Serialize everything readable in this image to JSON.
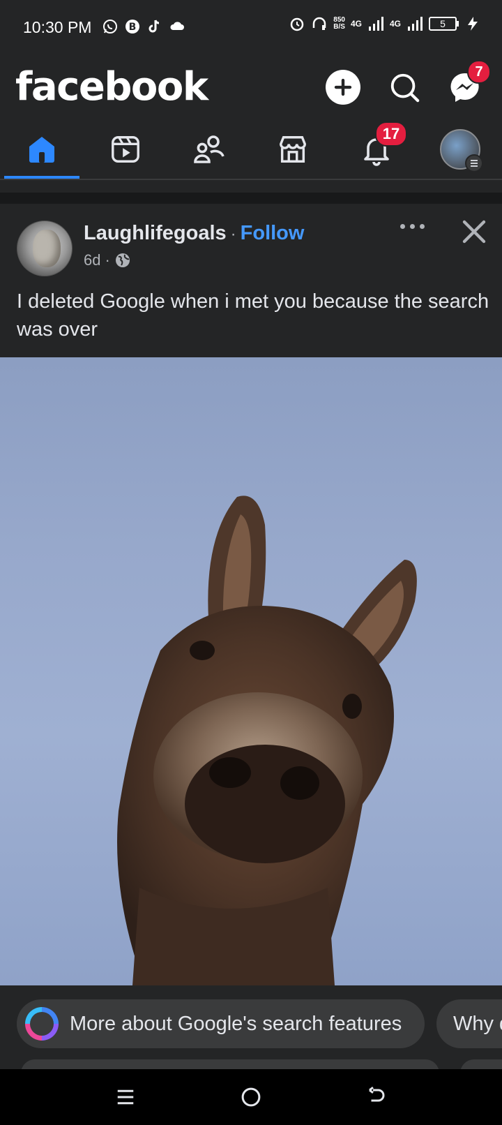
{
  "status_bar": {
    "time": "10:30 PM",
    "net_speed_value": "850",
    "net_speed_unit": "B/S",
    "signal1": "4G",
    "signal2": "4G",
    "battery": "5"
  },
  "header": {
    "logo": "facebook",
    "messenger_badge": "7"
  },
  "nav_tabs": {
    "active": "home",
    "notifications_badge": "17"
  },
  "post": {
    "author": "Laughlifegoals",
    "follow_label": "Follow",
    "age": "6d",
    "text": "I deleted Google when i met you because the search was over"
  },
  "suggestions": {
    "pill1": "More about Google's search features",
    "pill2": "Why d"
  },
  "colors": {
    "background": "#242526",
    "accent": "#2d88ff",
    "badge": "#e41e3f",
    "follow": "#4599ff"
  }
}
